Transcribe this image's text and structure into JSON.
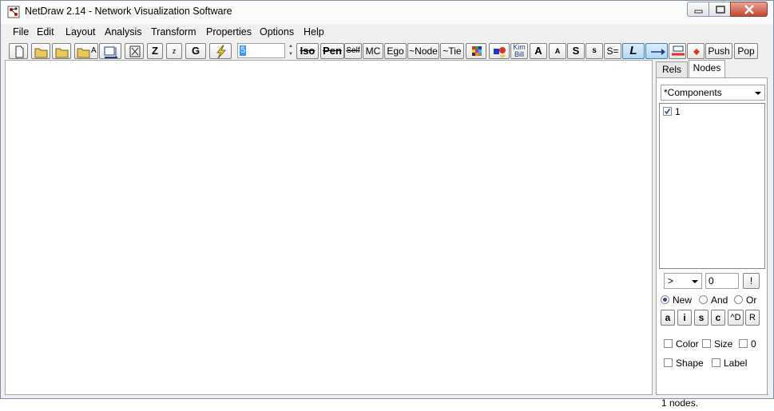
{
  "window": {
    "title": "NetDraw 2.14 - Network Visualization Software",
    "app_icon": "netdraw-app-icon",
    "controls": [
      "minimize-icon",
      "maximize-icon",
      "close-icon"
    ]
  },
  "menubar": {
    "items": [
      "File",
      "Edit",
      "Layout",
      "Analysis",
      "Transform",
      "Properties",
      "Options",
      "Help"
    ]
  },
  "toolbar": {
    "buttons": {
      "new": "new-file-icon",
      "open": "open-folder-icon",
      "open2": "open-folder-icon",
      "open3": "open-folder-icon",
      "open_a_label": "A",
      "export": "export-image-icon",
      "fit": "fit-screen-icon",
      "zoom_in": "Z",
      "zoom_out": "z",
      "layout_g": "G",
      "lightning": "lightning-icon",
      "iso": "Iso",
      "pen": "Pen",
      "self": "Self",
      "mc": "MC",
      "ego": "Ego",
      "not_node": "~Node",
      "not_tie": "~Tie",
      "color_grid": "color-grid-icon",
      "shape_tool": "shape-tool-icon",
      "kim_top": "Kim",
      "kim_bottom": "Bill",
      "font_big": "A",
      "font_small": "A",
      "size_big": "S",
      "size_small": "s",
      "size_equal": "S=",
      "line_l": "L",
      "arrow": "arrow-right-icon",
      "line_weight": "line-weight-icon",
      "node_red": "red-node-icon",
      "push": "Push",
      "pop": "Pop"
    },
    "spinner_value": "5"
  },
  "side_panel": {
    "tabs": [
      "Rels",
      "Nodes"
    ],
    "active_tab": "Nodes",
    "attribute_select": "*Components",
    "list_items": [
      {
        "label": "1",
        "checked": true
      }
    ],
    "compare_op": ">",
    "compare_value": "0",
    "go_label": "!",
    "radio": [
      {
        "label": "New",
        "selected": true
      },
      {
        "label": "And",
        "selected": false
      },
      {
        "label": "Or",
        "selected": false
      }
    ],
    "small_buttons": [
      "a",
      "i",
      "s",
      "c",
      "^D",
      "R"
    ],
    "options_row1": [
      {
        "label": "Color",
        "checked": false
      },
      {
        "label": "Size",
        "checked": false
      },
      {
        "label": "0",
        "checked": false
      }
    ],
    "options_row2": [
      {
        "label": "Shape",
        "checked": false
      },
      {
        "label": "Label",
        "checked": false
      }
    ],
    "status": "1 nodes."
  },
  "colors": {
    "close_button": "#c7452f",
    "highlight": "#3399ff",
    "active_tool": "#c6def5"
  }
}
